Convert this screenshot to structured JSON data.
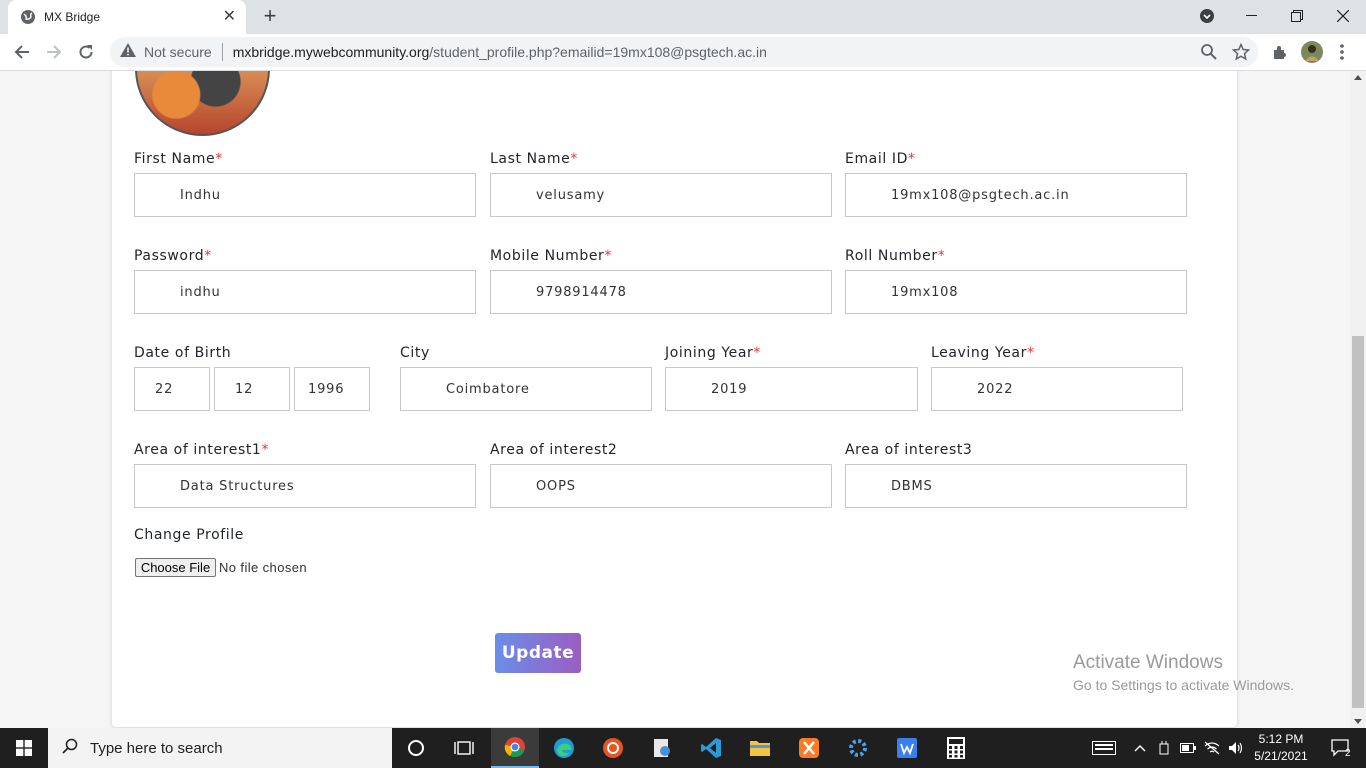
{
  "browser": {
    "tab_title": "MX Bridge",
    "address": {
      "security_label": "Not secure",
      "host": "mxbridge.mywebcommunity.org",
      "path": "/student_profile.php?emailid=19mx108@psgtech.ac.in"
    }
  },
  "form": {
    "first_name": {
      "label": "First Name",
      "required": "*",
      "value": "Indhu"
    },
    "last_name": {
      "label": "Last Name",
      "required": "*",
      "value": "velusamy"
    },
    "email": {
      "label": "Email ID",
      "required": "*",
      "value": "19mx108@psgtech.ac.in"
    },
    "password": {
      "label": "Password",
      "required": "*",
      "value": "indhu"
    },
    "mobile": {
      "label": "Mobile Number",
      "required": "*",
      "value": "9798914478"
    },
    "roll": {
      "label": "Roll Number",
      "required": "*",
      "value": "19mx108"
    },
    "dob": {
      "label": "Date of Birth",
      "day": "22",
      "month": "12",
      "year": "1996"
    },
    "city": {
      "label": "City",
      "value": "Coimbatore"
    },
    "joining_year": {
      "label": "Joining Year",
      "required": "*",
      "value": "2019"
    },
    "leaving_year": {
      "label": "Leaving Year",
      "required": "*",
      "value": "2022"
    },
    "interest1": {
      "label": "Area of interest1",
      "required": "*",
      "value": "Data Structures"
    },
    "interest2": {
      "label": "Area of interest2",
      "value": "OOPS"
    },
    "interest3": {
      "label": "Area of interest3",
      "value": "DBMS"
    },
    "change_profile": {
      "label": "Change Profile",
      "button": "Choose File",
      "status": "No file chosen"
    },
    "update_label": "Update"
  },
  "watermark": {
    "line1": "Activate Windows",
    "line2": "Go to Settings to activate Windows."
  },
  "taskbar": {
    "search_placeholder": "Type here to search",
    "time": "5:12 PM",
    "date": "5/21/2021",
    "notification_count": "2"
  },
  "colors": {
    "required": "#e53935",
    "update_gradient_start": "#6a8ee8",
    "update_gradient_end": "#9b5dc2"
  }
}
